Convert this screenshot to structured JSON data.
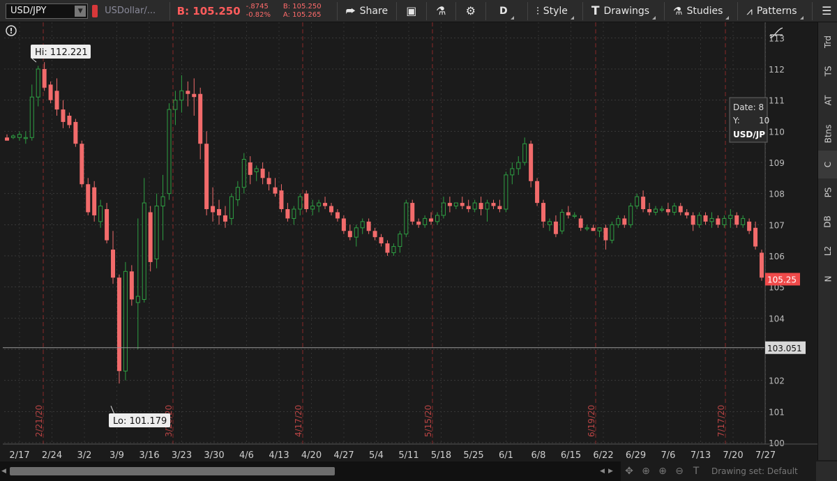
{
  "toolbar": {
    "symbol": "USD/JPY",
    "description": "USDollar/...",
    "bid_big": "B: 105.250",
    "change_abs": "-.8745",
    "change_pct": "-0.82%",
    "bid": "B: 105.250",
    "ask": "A: 105.265",
    "share_label": "Share",
    "period_label": "D",
    "style_label": "Style",
    "drawings_label": "Drawings",
    "studies_label": "Studies",
    "patterns_label": "Patterns"
  },
  "sidebar": {
    "items": [
      {
        "label": "Trd"
      },
      {
        "label": "TS"
      },
      {
        "label": "AT"
      },
      {
        "label": "Btns"
      },
      {
        "label": "C"
      },
      {
        "label": "PS"
      },
      {
        "label": "DB"
      },
      {
        "label": "L2"
      },
      {
        "label": "N"
      }
    ]
  },
  "bottom": {
    "drawing_set": "Drawing set: Default"
  },
  "colors": {
    "up": "#2ea043",
    "down": "#f26b6b",
    "price_tag": "#f04a4a"
  },
  "chart_data": {
    "type": "candlestick",
    "symbol": "USD/JPY",
    "ylim": [
      100,
      113
    ],
    "y_ticks": [
      100,
      101,
      102,
      103,
      104,
      105,
      106,
      107,
      108,
      109,
      110,
      111,
      112,
      113
    ],
    "x_ticks": [
      "2/17",
      "2/24",
      "3/2",
      "3/9",
      "3/16",
      "3/23",
      "3/30",
      "4/6",
      "4/13",
      "4/20",
      "4/27",
      "5/4",
      "5/11",
      "5/18",
      "5/25",
      "6/1",
      "6/8",
      "6/15",
      "6/22",
      "6/29",
      "7/6",
      "7/13",
      "7/20",
      "7/27"
    ],
    "period_markers": [
      "2/21/20",
      "3/20/20",
      "4/17/20",
      "5/15/20",
      "6/19/20",
      "7/17/20"
    ],
    "hi_label": "Hi: 112.221",
    "lo_label": "Lo: 101.179",
    "last_price": "105.25",
    "crosshair_price": "103.051",
    "tooltip": {
      "date": "Date: 8",
      "y": "Y:",
      "y_val": "10",
      "symbol": "USD/JP"
    },
    "candles": [
      {
        "o": 109.8,
        "h": 109.9,
        "l": 109.7,
        "c": 109.7
      },
      {
        "o": 109.8,
        "h": 109.9,
        "l": 109.75,
        "c": 109.85
      },
      {
        "o": 109.8,
        "h": 110.0,
        "l": 109.7,
        "c": 109.9
      },
      {
        "o": 109.8,
        "h": 110.0,
        "l": 109.6,
        "c": 109.8
      },
      {
        "o": 109.8,
        "h": 111.5,
        "l": 109.7,
        "c": 111.1
      },
      {
        "o": 111.1,
        "h": 112.1,
        "l": 110.8,
        "c": 112.0
      },
      {
        "o": 112.0,
        "h": 112.22,
        "l": 111.3,
        "c": 111.4
      },
      {
        "o": 111.5,
        "h": 111.6,
        "l": 110.9,
        "c": 111.0
      },
      {
        "o": 111.3,
        "h": 111.7,
        "l": 110.5,
        "c": 110.7
      },
      {
        "o": 110.7,
        "h": 111.0,
        "l": 110.1,
        "c": 110.3
      },
      {
        "o": 110.5,
        "h": 110.6,
        "l": 110.1,
        "c": 110.2
      },
      {
        "o": 110.3,
        "h": 110.4,
        "l": 109.5,
        "c": 109.6
      },
      {
        "o": 109.6,
        "h": 109.7,
        "l": 108.2,
        "c": 108.3
      },
      {
        "o": 108.3,
        "h": 108.5,
        "l": 107.3,
        "c": 107.4
      },
      {
        "o": 108.2,
        "h": 108.4,
        "l": 107.1,
        "c": 107.3
      },
      {
        "o": 107.1,
        "h": 107.8,
        "l": 106.9,
        "c": 107.6
      },
      {
        "o": 107.5,
        "h": 107.7,
        "l": 106.4,
        "c": 106.5
      },
      {
        "o": 106.2,
        "h": 106.8,
        "l": 105.1,
        "c": 105.3
      },
      {
        "o": 105.3,
        "h": 105.4,
        "l": 101.9,
        "c": 102.3
      },
      {
        "o": 102.3,
        "h": 105.8,
        "l": 102.0,
        "c": 105.5
      },
      {
        "o": 105.5,
        "h": 105.7,
        "l": 104.4,
        "c": 104.6
      },
      {
        "o": 104.5,
        "h": 107.2,
        "l": 103.0,
        "c": 104.7
      },
      {
        "o": 104.6,
        "h": 108.5,
        "l": 104.5,
        "c": 107.7
      },
      {
        "o": 107.4,
        "h": 107.6,
        "l": 105.5,
        "c": 105.8
      },
      {
        "o": 105.9,
        "h": 108.0,
        "l": 105.6,
        "c": 107.6
      },
      {
        "o": 107.6,
        "h": 108.6,
        "l": 106.5,
        "c": 107.9
      },
      {
        "o": 108.0,
        "h": 110.9,
        "l": 107.8,
        "c": 110.7
      },
      {
        "o": 110.7,
        "h": 111.3,
        "l": 110.2,
        "c": 111.0
      },
      {
        "o": 111.0,
        "h": 111.8,
        "l": 110.6,
        "c": 111.3
      },
      {
        "o": 111.3,
        "h": 111.6,
        "l": 110.8,
        "c": 111.2
      },
      {
        "o": 111.2,
        "h": 111.7,
        "l": 110.5,
        "c": 111.1
      },
      {
        "o": 111.2,
        "h": 111.4,
        "l": 109.1,
        "c": 109.6
      },
      {
        "o": 109.6,
        "h": 110.0,
        "l": 107.3,
        "c": 107.5
      },
      {
        "o": 107.6,
        "h": 108.2,
        "l": 107.1,
        "c": 107.4
      },
      {
        "o": 107.5,
        "h": 107.8,
        "l": 107.0,
        "c": 107.3
      },
      {
        "o": 107.3,
        "h": 107.6,
        "l": 106.9,
        "c": 107.1
      },
      {
        "o": 107.2,
        "h": 108.0,
        "l": 107.0,
        "c": 107.9
      },
      {
        "o": 107.8,
        "h": 108.4,
        "l": 107.6,
        "c": 108.2
      },
      {
        "o": 108.2,
        "h": 109.3,
        "l": 108.0,
        "c": 109.1
      },
      {
        "o": 109.0,
        "h": 109.2,
        "l": 108.3,
        "c": 108.6
      },
      {
        "o": 108.7,
        "h": 108.9,
        "l": 108.4,
        "c": 108.8
      },
      {
        "o": 108.8,
        "h": 109.0,
        "l": 108.3,
        "c": 108.5
      },
      {
        "o": 108.5,
        "h": 108.7,
        "l": 108.1,
        "c": 108.3
      },
      {
        "o": 108.2,
        "h": 108.5,
        "l": 107.9,
        "c": 108.0
      },
      {
        "o": 108.1,
        "h": 108.3,
        "l": 107.4,
        "c": 107.5
      },
      {
        "o": 107.5,
        "h": 107.7,
        "l": 107.1,
        "c": 107.2
      },
      {
        "o": 107.2,
        "h": 107.6,
        "l": 107.0,
        "c": 107.5
      },
      {
        "o": 107.5,
        "h": 108.0,
        "l": 107.3,
        "c": 107.9
      },
      {
        "o": 108.0,
        "h": 108.1,
        "l": 107.4,
        "c": 107.5
      },
      {
        "o": 107.5,
        "h": 107.8,
        "l": 107.3,
        "c": 107.6
      },
      {
        "o": 107.6,
        "h": 107.8,
        "l": 107.4,
        "c": 107.7
      },
      {
        "o": 107.7,
        "h": 107.9,
        "l": 107.5,
        "c": 107.6
      },
      {
        "o": 107.6,
        "h": 107.7,
        "l": 107.3,
        "c": 107.4
      },
      {
        "o": 107.4,
        "h": 107.5,
        "l": 107.1,
        "c": 107.2
      },
      {
        "o": 107.2,
        "h": 107.3,
        "l": 106.7,
        "c": 106.8
      },
      {
        "o": 106.8,
        "h": 107.0,
        "l": 106.5,
        "c": 106.6
      },
      {
        "o": 106.6,
        "h": 107.0,
        "l": 106.3,
        "c": 106.9
      },
      {
        "o": 106.9,
        "h": 107.2,
        "l": 106.7,
        "c": 107.1
      },
      {
        "o": 107.1,
        "h": 107.2,
        "l": 106.7,
        "c": 106.8
      },
      {
        "o": 106.8,
        "h": 106.9,
        "l": 106.5,
        "c": 106.6
      },
      {
        "o": 106.6,
        "h": 106.7,
        "l": 106.3,
        "c": 106.4
      },
      {
        "o": 106.4,
        "h": 106.5,
        "l": 106.0,
        "c": 106.1
      },
      {
        "o": 106.1,
        "h": 106.4,
        "l": 106.0,
        "c": 106.3
      },
      {
        "o": 106.3,
        "h": 106.8,
        "l": 106.1,
        "c": 106.7
      },
      {
        "o": 106.7,
        "h": 107.8,
        "l": 106.6,
        "c": 107.7
      },
      {
        "o": 107.7,
        "h": 107.8,
        "l": 107.0,
        "c": 107.1
      },
      {
        "o": 107.1,
        "h": 107.2,
        "l": 106.9,
        "c": 107.0
      },
      {
        "o": 107.0,
        "h": 107.3,
        "l": 106.9,
        "c": 107.2
      },
      {
        "o": 107.2,
        "h": 107.4,
        "l": 107.0,
        "c": 107.1
      },
      {
        "o": 107.1,
        "h": 107.4,
        "l": 107.0,
        "c": 107.3
      },
      {
        "o": 107.3,
        "h": 107.9,
        "l": 107.2,
        "c": 107.7
      },
      {
        "o": 107.7,
        "h": 107.9,
        "l": 107.4,
        "c": 107.6
      },
      {
        "o": 107.6,
        "h": 107.7,
        "l": 107.5,
        "c": 107.7
      },
      {
        "o": 107.7,
        "h": 107.9,
        "l": 107.5,
        "c": 107.6
      },
      {
        "o": 107.6,
        "h": 107.8,
        "l": 107.4,
        "c": 107.5
      },
      {
        "o": 107.5,
        "h": 107.8,
        "l": 107.4,
        "c": 107.7
      },
      {
        "o": 107.7,
        "h": 107.9,
        "l": 107.3,
        "c": 107.5
      },
      {
        "o": 107.5,
        "h": 107.8,
        "l": 107.1,
        "c": 107.7
      },
      {
        "o": 107.7,
        "h": 107.8,
        "l": 107.5,
        "c": 107.6
      },
      {
        "o": 107.6,
        "h": 107.8,
        "l": 107.4,
        "c": 107.5
      },
      {
        "o": 107.5,
        "h": 108.7,
        "l": 107.4,
        "c": 108.6
      },
      {
        "o": 108.6,
        "h": 109.0,
        "l": 108.3,
        "c": 108.8
      },
      {
        "o": 108.8,
        "h": 109.2,
        "l": 108.6,
        "c": 109.0
      },
      {
        "o": 109.0,
        "h": 109.8,
        "l": 108.9,
        "c": 109.6
      },
      {
        "o": 109.6,
        "h": 109.7,
        "l": 108.2,
        "c": 108.4
      },
      {
        "o": 108.4,
        "h": 108.5,
        "l": 107.6,
        "c": 107.7
      },
      {
        "o": 107.7,
        "h": 107.8,
        "l": 106.9,
        "c": 107.1
      },
      {
        "o": 107.0,
        "h": 107.2,
        "l": 106.8,
        "c": 107.1
      },
      {
        "o": 107.1,
        "h": 107.3,
        "l": 106.6,
        "c": 106.7
      },
      {
        "o": 106.8,
        "h": 107.5,
        "l": 106.7,
        "c": 107.4
      },
      {
        "o": 107.4,
        "h": 107.6,
        "l": 107.2,
        "c": 107.3
      },
      {
        "o": 107.3,
        "h": 107.4,
        "l": 107.2,
        "c": 107.3
      },
      {
        "o": 107.2,
        "h": 107.3,
        "l": 106.8,
        "c": 106.9
      },
      {
        "o": 106.9,
        "h": 107.0,
        "l": 106.8,
        "c": 106.9
      },
      {
        "o": 106.9,
        "h": 107.0,
        "l": 106.8,
        "c": 106.8
      },
      {
        "o": 106.8,
        "h": 106.9,
        "l": 106.6,
        "c": 106.9
      },
      {
        "o": 106.9,
        "h": 107.0,
        "l": 106.2,
        "c": 106.5
      },
      {
        "o": 106.5,
        "h": 107.1,
        "l": 106.4,
        "c": 107.0
      },
      {
        "o": 107.0,
        "h": 107.3,
        "l": 106.9,
        "c": 107.2
      },
      {
        "o": 107.2,
        "h": 107.3,
        "l": 106.9,
        "c": 107.0
      },
      {
        "o": 107.0,
        "h": 107.7,
        "l": 106.9,
        "c": 107.6
      },
      {
        "o": 107.6,
        "h": 108.0,
        "l": 107.5,
        "c": 107.9
      },
      {
        "o": 107.9,
        "h": 108.1,
        "l": 107.4,
        "c": 107.5
      },
      {
        "o": 107.5,
        "h": 107.7,
        "l": 107.3,
        "c": 107.4
      },
      {
        "o": 107.4,
        "h": 107.6,
        "l": 107.3,
        "c": 107.5
      },
      {
        "o": 107.5,
        "h": 107.6,
        "l": 107.4,
        "c": 107.5
      },
      {
        "o": 107.5,
        "h": 107.7,
        "l": 107.3,
        "c": 107.4
      },
      {
        "o": 107.4,
        "h": 107.7,
        "l": 107.3,
        "c": 107.6
      },
      {
        "o": 107.6,
        "h": 107.7,
        "l": 107.3,
        "c": 107.4
      },
      {
        "o": 107.4,
        "h": 107.5,
        "l": 107.2,
        "c": 107.3
      },
      {
        "o": 107.3,
        "h": 107.4,
        "l": 106.8,
        "c": 107.0
      },
      {
        "o": 107.0,
        "h": 107.4,
        "l": 106.9,
        "c": 107.3
      },
      {
        "o": 107.3,
        "h": 107.4,
        "l": 107.0,
        "c": 107.1
      },
      {
        "o": 107.1,
        "h": 107.4,
        "l": 106.9,
        "c": 107.2
      },
      {
        "o": 107.2,
        "h": 107.3,
        "l": 106.9,
        "c": 107.0
      },
      {
        "o": 107.0,
        "h": 107.3,
        "l": 106.9,
        "c": 107.2
      },
      {
        "o": 107.2,
        "h": 107.5,
        "l": 106.9,
        "c": 107.3
      },
      {
        "o": 107.3,
        "h": 107.4,
        "l": 106.9,
        "c": 107.0
      },
      {
        "o": 107.0,
        "h": 107.3,
        "l": 106.9,
        "c": 107.2
      },
      {
        "o": 107.1,
        "h": 107.2,
        "l": 106.7,
        "c": 106.8
      },
      {
        "o": 106.9,
        "h": 107.1,
        "l": 106.2,
        "c": 106.3
      },
      {
        "o": 106.1,
        "h": 106.2,
        "l": 105.2,
        "c": 105.3
      }
    ]
  }
}
